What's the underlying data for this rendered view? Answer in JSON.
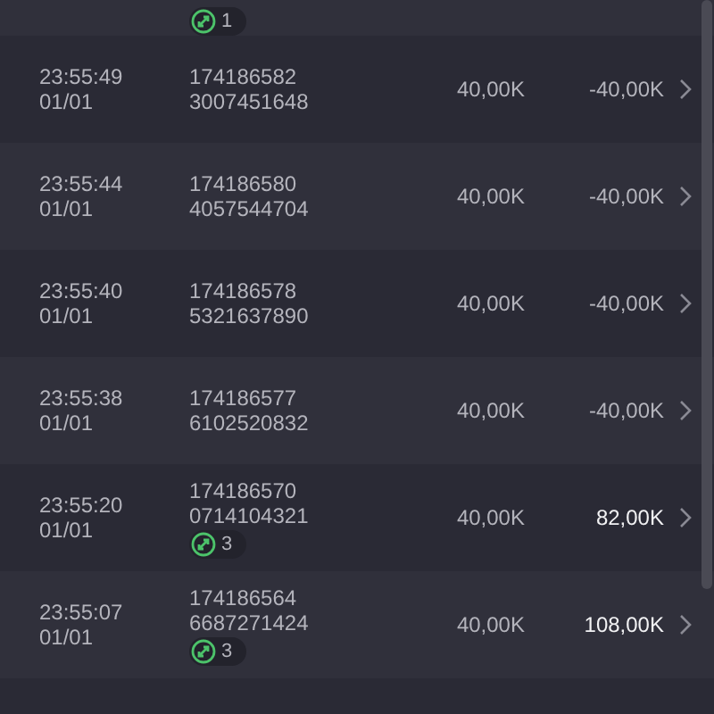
{
  "top_partial_row": {
    "badge_count": "1"
  },
  "rows": [
    {
      "time": "23:55:49",
      "date": "01/01",
      "id_line1": "174186582",
      "id_line2": "3007451648",
      "amount": "40,00K",
      "result": "-40,00K",
      "win": false
    },
    {
      "time": "23:55:44",
      "date": "01/01",
      "id_line1": "174186580",
      "id_line2": "4057544704",
      "amount": "40,00K",
      "result": "-40,00K",
      "win": false
    },
    {
      "time": "23:55:40",
      "date": "01/01",
      "id_line1": "174186578",
      "id_line2": "5321637890",
      "amount": "40,00K",
      "result": "-40,00K",
      "win": false
    },
    {
      "time": "23:55:38",
      "date": "01/01",
      "id_line1": "174186577",
      "id_line2": "6102520832",
      "amount": "40,00K",
      "result": "-40,00K",
      "win": false
    },
    {
      "time": "23:55:20",
      "date": "01/01",
      "id_line1": "174186570",
      "id_line2": "0714104321",
      "amount": "40,00K",
      "result": "82,00K",
      "win": true,
      "badge_count": "3"
    },
    {
      "time": "23:55:07",
      "date": "01/01",
      "id_line1": "174186564",
      "id_line2": "6687271424",
      "amount": "40,00K",
      "result": "108,00K",
      "win": true,
      "badge_count": "3"
    }
  ]
}
